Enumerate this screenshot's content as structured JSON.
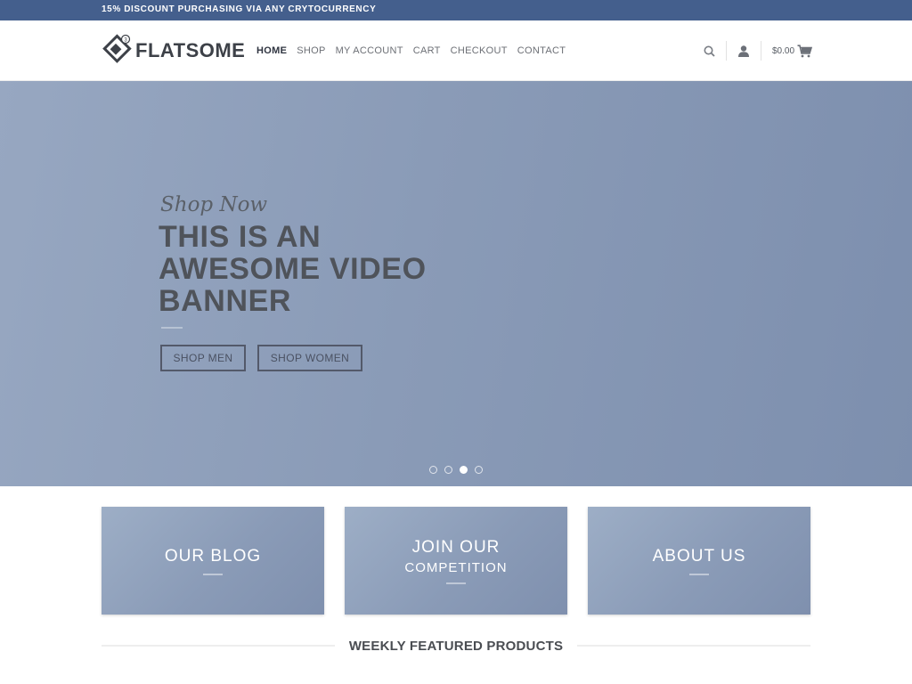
{
  "topbar": {
    "promo_text": "15% DISCOUNT PURCHASING VIA ANY CRYTOCURRENCY"
  },
  "header": {
    "logo_text": "FLATSOME",
    "nav": [
      {
        "label": "HOME",
        "active": true
      },
      {
        "label": "SHOP"
      },
      {
        "label": "MY ACCOUNT"
      },
      {
        "label": "CART"
      },
      {
        "label": "CHECKOUT"
      },
      {
        "label": "CONTACT"
      }
    ],
    "icons": {
      "search": "search-icon",
      "account": "user-icon",
      "cart": "cart-icon"
    },
    "cart_total": "$0.00"
  },
  "hero": {
    "script_text": "Shop Now",
    "title_lines": [
      "THIS IS AN",
      "AWESOME VIDEO",
      "BANNER"
    ],
    "buttons": {
      "men": "SHOP MEN",
      "women": "SHOP WOMEN"
    },
    "slides": {
      "count": 4,
      "active_index": 2
    }
  },
  "tiles": [
    {
      "title": "OUR BLOG",
      "subtitle": ""
    },
    {
      "title": "JOIN OUR",
      "subtitle": "COMPETITION"
    },
    {
      "title": "ABOUT US",
      "subtitle": ""
    }
  ],
  "section": {
    "title": "WEEKLY FEATURED PRODUCTS"
  },
  "colors": {
    "topbar_bg": "#445f8d",
    "hero_bg": "#8a9bb7",
    "text_dark": "#4f535a"
  }
}
